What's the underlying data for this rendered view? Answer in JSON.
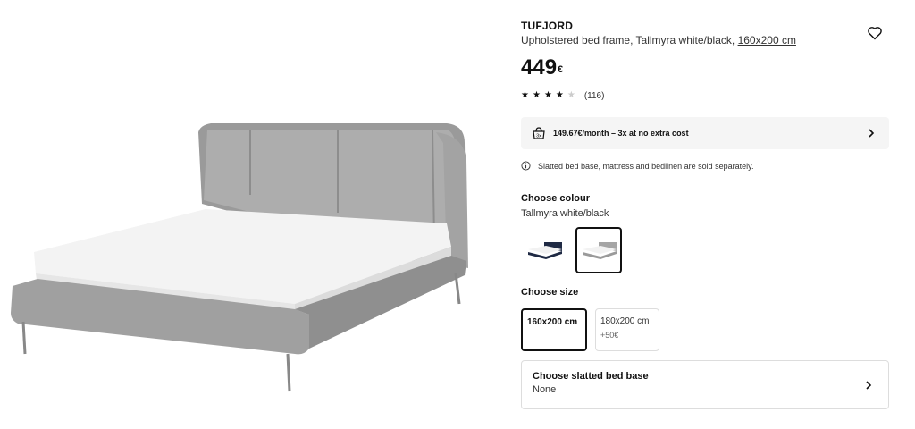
{
  "product": {
    "name": "TUFJORD",
    "description": "Upholstered bed frame, Tallmyra white/black,",
    "size_link": "160x200 cm",
    "price": "449",
    "currency": "€",
    "rating": {
      "stars": 4,
      "max_stars": 5,
      "count": "(116)"
    }
  },
  "payment": {
    "text": "149.67€/month – 3x at no extra cost",
    "icon": "payment-bag-icon"
  },
  "notice": {
    "text": "Slatted bed base, mattress and bedlinen are sold separately.",
    "icon": "info-icon"
  },
  "colour": {
    "title": "Choose colour",
    "selected": "Tallmyra white/black",
    "options": [
      "dark-blue-bed-thumbnail",
      "grey-bed-thumbnail"
    ]
  },
  "size": {
    "title": "Choose size",
    "options": [
      {
        "label": "160x200 cm",
        "extra": ""
      },
      {
        "label": "180x200 cm",
        "extra": "+50€"
      }
    ]
  },
  "bed_base": {
    "title": "Choose slatted bed base",
    "value": "None"
  },
  "icons": {
    "favorite": "heart-icon",
    "chevron": "chevron-right-icon"
  },
  "colors": {
    "accent": "#111111",
    "panel": "#f5f5f5",
    "border": "#dddddd"
  }
}
